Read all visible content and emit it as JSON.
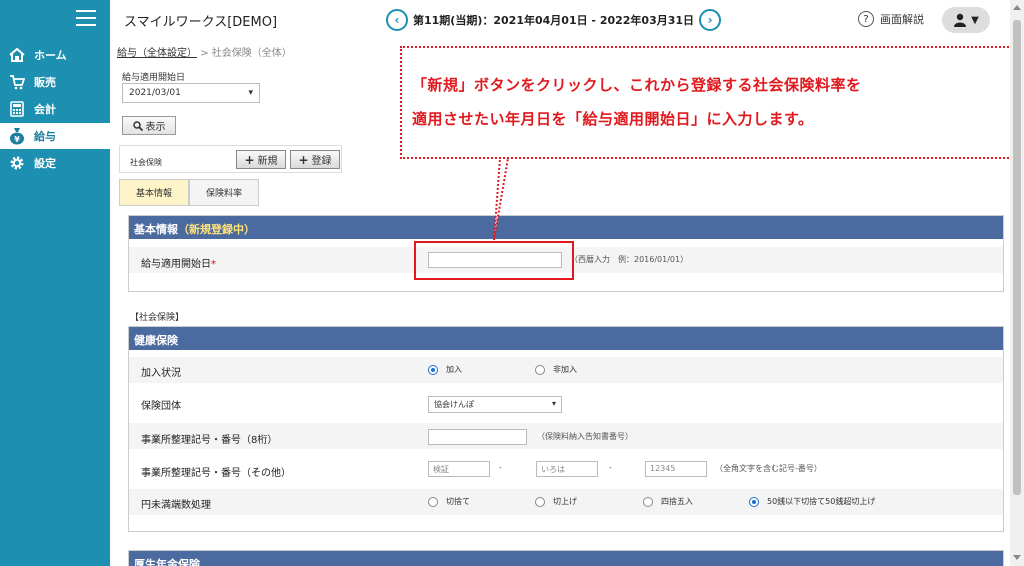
{
  "sidebar": {
    "items": [
      {
        "label": "ホーム",
        "icon": "home-icon"
      },
      {
        "label": "販売",
        "icon": "cart-icon"
      },
      {
        "label": "会計",
        "icon": "calculator-icon"
      },
      {
        "label": "給与",
        "icon": "money-bag-icon"
      },
      {
        "label": "設定",
        "icon": "gear-icon"
      }
    ],
    "active_index": 3
  },
  "header": {
    "app_title": "スマイルワークス[DEMO]",
    "period": "第11期(当期)：2021年04月01日 - 2022年03月31日",
    "help_label": "画面解説"
  },
  "breadcrumb": {
    "parent": "給与（全体設定）",
    "separator": ">",
    "current": "社会保険（全体）"
  },
  "filter": {
    "start_label": "給与適用開始日",
    "start_value": "2021/03/01",
    "show_button": "表示"
  },
  "toolbar": {
    "label": "社会保険",
    "new_label": "新規",
    "register_label": "登録"
  },
  "tabs": [
    "基本情報",
    "保険料率"
  ],
  "basic_panel": {
    "title": "基本情報",
    "status": "（新規登録中）",
    "start_label": "給与適用開始日",
    "required_mark": "*",
    "start_value": "",
    "start_hint": "（西暦入力　例：2016/01/01）"
  },
  "social_section_label": "【社会保険】",
  "health_panel": {
    "title": "健康保険",
    "rows": {
      "join_label": "加入状況",
      "join_options": [
        "加入",
        "非加入"
      ],
      "join_selected": 0,
      "group_label": "保険団体",
      "group_value": "協会けんぽ",
      "office_no_label": "事業所整理記号・番号（8桁）",
      "office_no_value": "",
      "office_no_hint": "（保険料納入告知書番号）",
      "office_other_label": "事業所整理記号・番号（その他）",
      "office_other_placeholders": [
        "検証",
        "いろは",
        "12345"
      ],
      "office_other_sep": "-",
      "office_other_hint": "（全角文字を含む記号-番号）",
      "rounding_label": "円未満端数処理",
      "rounding_options": [
        "切捨て",
        "切上げ",
        "四捨五入",
        "50銭以下切捨て50銭超切上げ"
      ],
      "rounding_selected": 3
    }
  },
  "pension_panel": {
    "title": "厚生年金保険"
  },
  "callout": {
    "line1": "「新規」ボタンをクリックし、これから登録する社会保険料率を",
    "line2": "適用させたい年月日を「給与適用開始日」に入力します。",
    "color": "#e0191e"
  },
  "colors": {
    "sidebar": "#1d8fb0",
    "panel_header": "#4b6aa0",
    "status_text": "#ffe27a",
    "active_tab": "#fdf5c9"
  }
}
